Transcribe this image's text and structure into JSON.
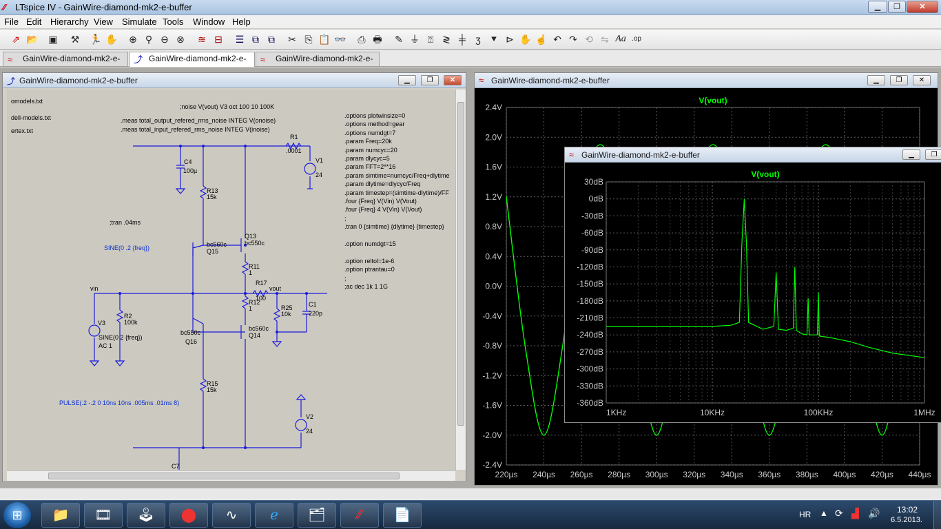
{
  "app": {
    "title": "LTspice IV - GainWire-diamond-mk2-e-buffer",
    "icon": "ltspice-logo-icon"
  },
  "menu": [
    "File",
    "Edit",
    "Hierarchy",
    "View",
    "Simulate",
    "Tools",
    "Window",
    "Help"
  ],
  "toolbar_icons": [
    "open-schematic-icon",
    "open-icon",
    "save-icon",
    "control-panel-icon",
    "run-icon",
    "halt-icon",
    "zoom-in-icon",
    "zoom-pan-icon",
    "zoom-out-icon",
    "zoom-fit-icon",
    "autoscale-icon",
    "tile-horizontal-icon",
    "tile-vertical-icon",
    "cascade-icon",
    "cut-icon",
    "copy-icon",
    "paste-icon",
    "find-icon",
    "print-setup-icon",
    "print-icon",
    "wire-icon",
    "ground-icon",
    "label-net-icon",
    "resistor-icon",
    "capacitor-icon",
    "inductor-icon",
    "diode-icon",
    "component-icon",
    "move-icon",
    "drag-icon",
    "undo-icon",
    "redo-icon",
    "rotate-icon",
    "mirror-icon",
    "text-icon",
    "spice-directive-icon"
  ],
  "tabs": [
    {
      "label": "GainWire-diamond-mk2-e-buffer",
      "kind": "plot"
    },
    {
      "label": "GainWire-diamond-mk2-e-buffer",
      "kind": "schematic"
    },
    {
      "label": "GainWire-diamond-mk2-e-buffer",
      "kind": "plot"
    }
  ],
  "schematic": {
    "title": "GainWire-diamond-mk2-e-buffer",
    "texts": {
      "f1": "omodels.txt",
      "f2": "dell-models.txt",
      "f3": "ertex.txt",
      "noise": ";noise V(vout) V3 oct 100 10 100K",
      "meas1": ".meas total_output_refered_rms_noise INTEG V(onoise)",
      "meas2": ".meas total_input_refered_rms_noise INTEG V(inoise)",
      "tran1": ";tran .04ms",
      "sine1": "SINE(0 .2 {freq})",
      "pulse": "PULSE(.2 -.2 0 10ns 10ns .005ms .01ms 8)",
      "vin": "vin",
      "vout": "vout",
      "v3": "V3",
      "v3val": "SINE(0 2 {freq})",
      "v3ac": "AC 1",
      "r2": "R2",
      "r2v": "100k",
      "r1": "R1",
      "r1v": ".0001",
      "v1": "V1",
      "v1v": "24",
      "v2": "V2",
      "v2v": "24",
      "c4": "C4",
      "c4v": "100µ",
      "r13": "R13",
      "r13v": "15k",
      "r15": "R15",
      "r15v": "15k",
      "r11": "R11",
      "r11v": "1",
      "r12": "R12",
      "r12v": "1",
      "r17": "R17",
      "r17v": "100",
      "r25": "R25",
      "r25v": "10k",
      "c1": "C1",
      "c1v": "220p",
      "c7": "C7",
      "q13": "Q13",
      "q13m": "bc550c",
      "q15": "Q15",
      "q15m": "bc560c",
      "q14": "Q14",
      "q14m": "bc560c",
      "q16": "Q16",
      "q16m": "bc550c",
      "directives": [
        ".options plotwinsize=0",
        ".options method=gear",
        ".options numdgt=7",
        ".param Freq=20k",
        ".param numcyc=20",
        ".param dlycyc=5",
        ".param FFT=2**16",
        ".param simtime=numcyc/Freq+dlytime",
        ".param dlytime=dlycyc/Freq",
        ".param timestep=(simtime-dlytime)/FF",
        ".four {Freq} V(Vin) V(Vout)",
        ".four {Freq} 4 V(Vin) V(Vout)",
        ";",
        ".tran 0 {simtime} {dlytime} {timestep}",
        "",
        ".option numdgt=15",
        "",
        ".option reltol=1e-6",
        ".option ptrantau=0",
        ";",
        ";ac dec 1k 1 1G"
      ]
    }
  },
  "chart_data": [
    {
      "type": "line",
      "title": "GainWire-diamond-mk2-e-buffer",
      "series": [
        {
          "name": "V(vout)",
          "color": "#00ff00",
          "x": [
            220,
            230,
            240,
            250,
            260,
            270,
            280,
            290,
            300,
            310,
            320,
            330,
            340,
            350,
            360,
            370,
            380,
            390,
            400,
            410,
            420,
            430,
            440
          ],
          "values": [
            1.2,
            -0.8,
            -2.0,
            -0.8,
            1.2,
            1.9,
            1.2,
            -0.8,
            -2.0,
            -0.8,
            1.2,
            1.9,
            1.2,
            -0.8,
            -2.0,
            -0.8,
            1.2,
            1.9,
            1.2,
            -0.8,
            -2.0,
            -0.8,
            1.2
          ]
        }
      ],
      "xlabel": "",
      "ylabel": "",
      "xunit": "µs",
      "yunit": "V",
      "xlim": [
        220,
        440
      ],
      "ylim": [
        -2.4,
        2.4
      ],
      "xticks": [
        "220µs",
        "240µs",
        "260µs",
        "280µs",
        "300µs",
        "320µs",
        "340µs",
        "360µs",
        "380µs",
        "400µs",
        "420µs",
        "440µs"
      ],
      "yticks": [
        "2.4V",
        "2.0V",
        "1.6V",
        "1.2V",
        "0.8V",
        "0.4V",
        "0.0V",
        "-0.4V",
        "-0.8V",
        "-1.2V",
        "-1.6V",
        "-2.0V",
        "-2.4V"
      ],
      "grid": true
    },
    {
      "type": "line",
      "title": "GainWire-diamond-mk2-e-buffer",
      "series": [
        {
          "name": "V(vout)",
          "color": "#00ff00",
          "x_khz": [
            1,
            3,
            10,
            15,
            18,
            19,
            20,
            21,
            22,
            30,
            38,
            40,
            42,
            50,
            58,
            60,
            62,
            70,
            78,
            80,
            82,
            90,
            98,
            100,
            102,
            120,
            140,
            200,
            300,
            500,
            1000
          ],
          "values_db": [
            -225,
            -225,
            -225,
            -223,
            -218,
            -80,
            0,
            -80,
            -218,
            -230,
            -225,
            -130,
            -230,
            -232,
            -228,
            -120,
            -232,
            -238,
            -240,
            -175,
            -240,
            -240,
            -240,
            -165,
            -242,
            -244,
            -246,
            -252,
            -262,
            -272,
            -280
          ]
        }
      ],
      "xlabel": "",
      "ylabel": "",
      "xscale": "log",
      "xlim": [
        1,
        1000
      ],
      "ylim": [
        -360,
        30
      ],
      "xticks": [
        "1KHz",
        "10KHz",
        "100KHz",
        "1MHz"
      ],
      "yticks": [
        "30dB",
        "0dB",
        "-30dB",
        "-60dB",
        "-90dB",
        "-120dB",
        "-150dB",
        "-180dB",
        "-210dB",
        "-240dB",
        "-270dB",
        "-300dB",
        "-330dB",
        "-360dB"
      ],
      "grid": true
    }
  ],
  "taskbar": {
    "lang": "HR",
    "time": "13:02",
    "date": "6.5.2013.",
    "apps": [
      "explorer-icon",
      "media-icon",
      "joystick-icon",
      "antivirus-icon",
      "oscilloscope-icon",
      "internet-explorer-icon",
      "file-manager-icon",
      "ltspice-icon",
      "notes-icon"
    ]
  }
}
